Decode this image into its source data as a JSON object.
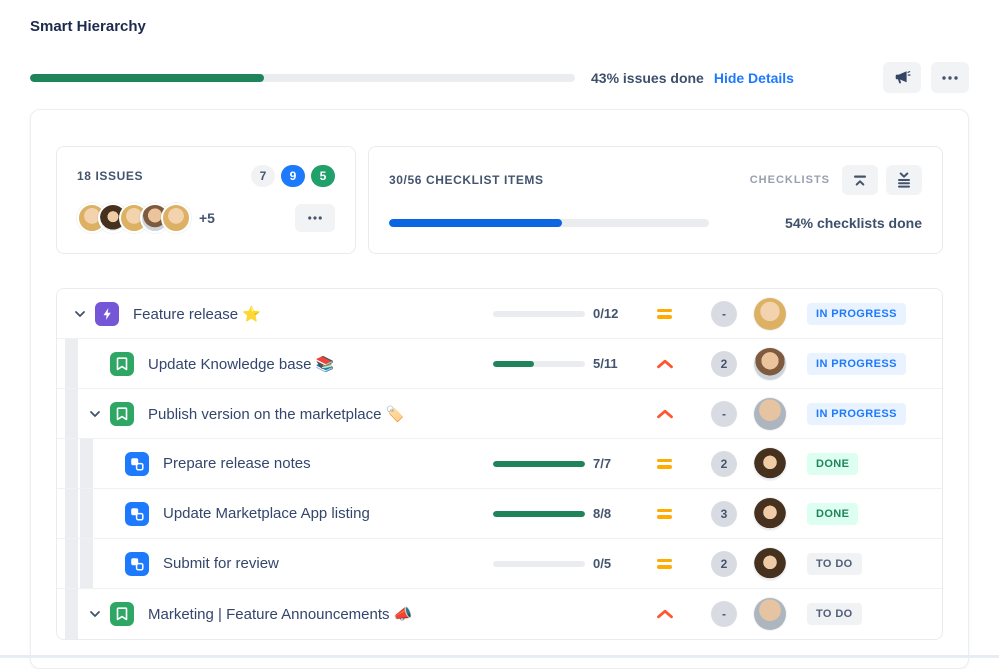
{
  "header": {
    "title": "Smart Hierarchy",
    "progress_percent": 43,
    "progress_label": "43% issues done",
    "hide_details_label": "Hide Details",
    "action_icons": [
      "megaphone-icon",
      "ellipsis-icon"
    ]
  },
  "summary": {
    "issues": {
      "label": "18 ISSUES",
      "status_counts": [
        {
          "value": "7",
          "status": "to do"
        },
        {
          "value": "9",
          "status": "in progress"
        },
        {
          "value": "5",
          "status": "done"
        }
      ],
      "visible_avatars": 5,
      "extra_assignees_label": "+5",
      "more_icon": "ellipsis-icon"
    },
    "checklists": {
      "label": "30/56 CHECKLIST ITEMS",
      "group_label": "CHECKLISTS",
      "collapse_icon": "collapse-all-icon",
      "expand_icon": "expand-all-icon",
      "progress_percent": 54,
      "progress_label": "54% checklists done"
    }
  },
  "colors": {
    "issues_progress": "#1F845A",
    "checklist_progress": "#0C66E4",
    "in_progress_badge": "#1D7AFC",
    "done_badge": "#1F845A",
    "todo_badge": "#505F79",
    "priority_medium": "#FFAB00",
    "priority_high": "#FF5630",
    "epic_icon": "#7456D6",
    "story_icon": "#2FA764",
    "subtask_icon": "#1D7AFC"
  },
  "table": {
    "rows": [
      {
        "level": 0,
        "expandable": true,
        "type": "epic",
        "title": "Feature release ⭐",
        "progress_percent": 0,
        "progress_label": "0/12",
        "priority": "medium",
        "estimate": "-",
        "avatar": "woman-blonde",
        "status": "IN PROGRESS",
        "status_type": "in-progress"
      },
      {
        "level": 1,
        "expandable": false,
        "type": "story",
        "title": "Update Knowledge base 📚",
        "progress_percent": 45,
        "progress_label": "5/11",
        "priority": "high",
        "estimate": "2",
        "avatar": "man-short-hair",
        "status": "IN PROGRESS",
        "status_type": "in-progress"
      },
      {
        "level": 1,
        "expandable": true,
        "type": "story",
        "title": "Publish version on the marketplace 🏷️",
        "progress_percent": null,
        "progress_label": "",
        "priority": "high",
        "estimate": "-",
        "avatar": "man-bald",
        "status": "IN PROGRESS",
        "status_type": "in-progress"
      },
      {
        "level": 2,
        "expandable": false,
        "type": "subtask",
        "title": "Prepare release notes",
        "progress_percent": 100,
        "progress_label": "7/7",
        "priority": "medium",
        "estimate": "2",
        "avatar": "woman-brunette",
        "status": "DONE",
        "status_type": "done"
      },
      {
        "level": 2,
        "expandable": false,
        "type": "subtask",
        "title": "Update Marketplace App listing",
        "progress_percent": 100,
        "progress_label": "8/8",
        "priority": "medium",
        "estimate": "3",
        "avatar": "woman-brunette",
        "status": "DONE",
        "status_type": "done"
      },
      {
        "level": 2,
        "expandable": false,
        "type": "subtask",
        "title": "Submit for review",
        "progress_percent": 0,
        "progress_label": "0/5",
        "priority": "medium",
        "estimate": "2",
        "avatar": "woman-brunette",
        "status": "TO DO",
        "status_type": "to-do"
      },
      {
        "level": 1,
        "expandable": true,
        "type": "story",
        "title": "Marketing | Feature Announcements 📣",
        "progress_percent": null,
        "progress_label": "",
        "priority": "high",
        "estimate": "-",
        "avatar": "man-bald",
        "status": "TO DO",
        "status_type": "to-do"
      }
    ]
  }
}
